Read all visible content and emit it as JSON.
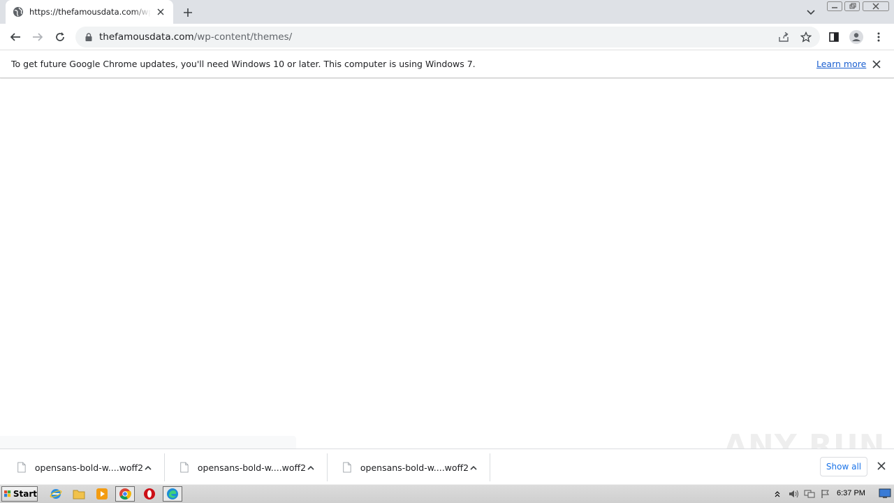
{
  "browser": {
    "tab": {
      "title": "https://thefamousdata.com/wp-content/themes/",
      "favicon": "globe-icon"
    },
    "address": {
      "host": "thefamousdata.com",
      "path": "/wp-content/themes/"
    },
    "colors": {
      "tabstrip": "#dee1e6",
      "link": "#1a5fd0",
      "accent": "#1a73e8"
    }
  },
  "infobar": {
    "message": "To get future Google Chrome updates, you'll need Windows 10 or later. This computer is using Windows 7.",
    "link": "Learn more"
  },
  "downloads": {
    "items": [
      {
        "name": "opensans-bold-w....woff2"
      },
      {
        "name": "opensans-bold-w....woff2"
      },
      {
        "name": "opensans-bold-w....woff2"
      }
    ],
    "show_all": "Show all"
  },
  "watermark": "ANY RUN",
  "taskbar": {
    "start_label": "Start",
    "clock": "6:37 PM"
  }
}
